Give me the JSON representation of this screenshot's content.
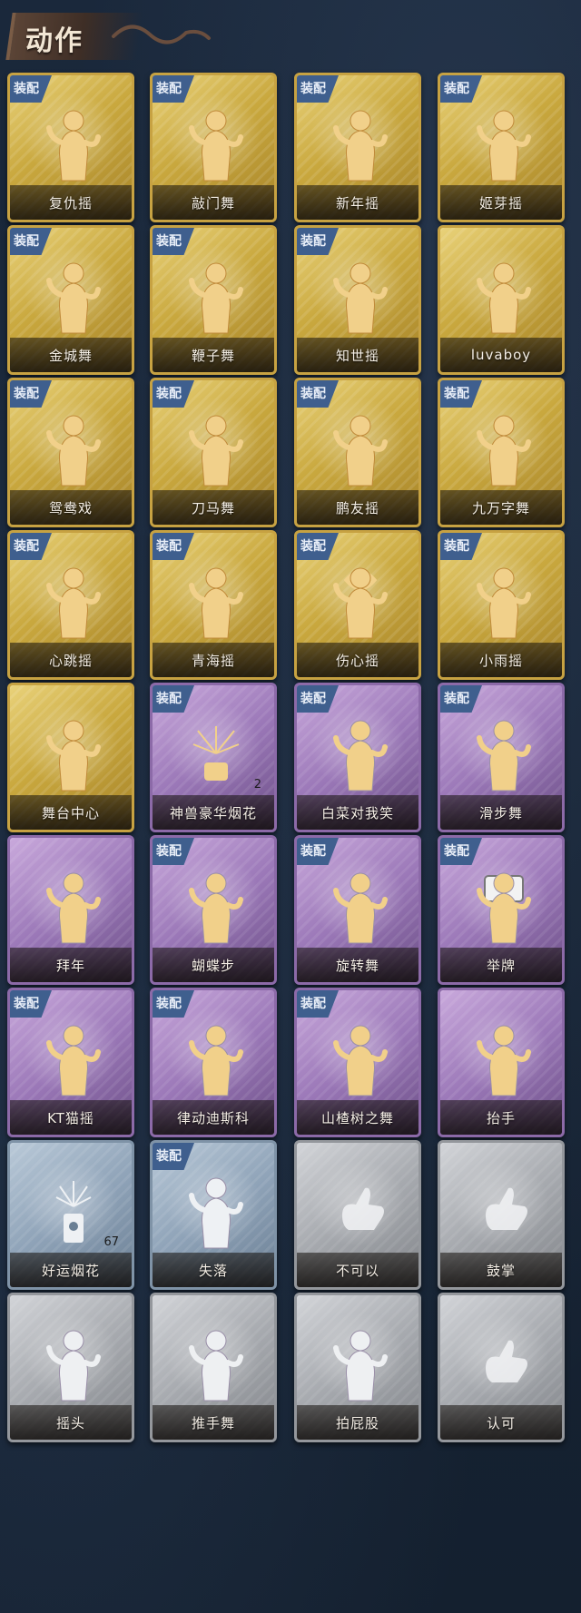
{
  "section_title": "动作",
  "badge_label": "装配",
  "colors": {
    "gold": "#c9a83e",
    "purple": "#9b78b8",
    "blue": "#8fa3b8",
    "gray": "#a6a9ae",
    "badge": "#3f5f8e",
    "background": "#152234"
  },
  "cards": [
    {
      "label": "复仇摇",
      "rarity": "gold",
      "equipped": true,
      "icon": "dance-figure-icon"
    },
    {
      "label": "敲门舞",
      "rarity": "gold",
      "equipped": true,
      "icon": "dance-figure-icon"
    },
    {
      "label": "新年摇",
      "rarity": "gold",
      "equipped": true,
      "icon": "dance-figure-icon"
    },
    {
      "label": "姬芽摇",
      "rarity": "gold",
      "equipped": true,
      "icon": "dance-figure-icon"
    },
    {
      "label": "金城舞",
      "rarity": "gold",
      "equipped": true,
      "icon": "dance-figure-icon"
    },
    {
      "label": "鞭子舞",
      "rarity": "gold",
      "equipped": true,
      "icon": "dance-figure-icon"
    },
    {
      "label": "知世摇",
      "rarity": "gold",
      "equipped": true,
      "icon": "dance-figure-icon"
    },
    {
      "label": "luvaboy",
      "rarity": "gold",
      "equipped": false,
      "icon": "dance-figure-icon"
    },
    {
      "label": "鸳鸯戏",
      "rarity": "gold",
      "equipped": true,
      "icon": "dance-figure-icon"
    },
    {
      "label": "刀马舞",
      "rarity": "gold",
      "equipped": true,
      "icon": "dance-figure-icon"
    },
    {
      "label": "鹏友摇",
      "rarity": "gold",
      "equipped": true,
      "icon": "dance-figure-icon"
    },
    {
      "label": "九万字舞",
      "rarity": "gold",
      "equipped": true,
      "icon": "dance-figure-icon"
    },
    {
      "label": "心跳摇",
      "rarity": "gold",
      "equipped": true,
      "icon": "dance-figure-icon"
    },
    {
      "label": "青海摇",
      "rarity": "gold",
      "equipped": true,
      "icon": "dance-figure-icon"
    },
    {
      "label": "伤心摇",
      "rarity": "gold",
      "equipped": true,
      "icon": "heart-hands-icon"
    },
    {
      "label": "小雨摇",
      "rarity": "gold",
      "equipped": true,
      "icon": "dance-figure-icon"
    },
    {
      "label": "舞台中心",
      "rarity": "gold",
      "equipped": false,
      "icon": "dance-figure-icon"
    },
    {
      "label": "神兽豪华烟花",
      "rarity": "purple",
      "equipped": true,
      "icon": "fireworks-icon",
      "count": "2"
    },
    {
      "label": "白菜对我笑",
      "rarity": "purple",
      "equipped": true,
      "icon": "dance-figure-icon"
    },
    {
      "label": "滑步舞",
      "rarity": "purple",
      "equipped": true,
      "icon": "dance-figure-icon"
    },
    {
      "label": "拜年",
      "rarity": "purple",
      "equipped": false,
      "icon": "bow-figure-icon"
    },
    {
      "label": "蝴蝶步",
      "rarity": "purple",
      "equipped": true,
      "icon": "dance-figure-icon"
    },
    {
      "label": "旋转舞",
      "rarity": "purple",
      "equipped": true,
      "icon": "spin-figure-icon"
    },
    {
      "label": "举牌",
      "rarity": "purple",
      "equipped": true,
      "icon": "sign-figure-icon"
    },
    {
      "label": "KT猫摇",
      "rarity": "purple",
      "equipped": true,
      "icon": "dance-figure-icon"
    },
    {
      "label": "律动迪斯科",
      "rarity": "purple",
      "equipped": true,
      "icon": "disco-figure-icon"
    },
    {
      "label": "山楂树之舞",
      "rarity": "purple",
      "equipped": true,
      "icon": "dance-figure-icon"
    },
    {
      "label": "抬手",
      "rarity": "purple",
      "equipped": false,
      "icon": "raise-hand-icon"
    },
    {
      "label": "好运烟花",
      "rarity": "blue",
      "equipped": false,
      "icon": "firework-can-icon",
      "count": "67"
    },
    {
      "label": "失落",
      "rarity": "blue",
      "equipped": true,
      "icon": "crawl-figure-icon"
    },
    {
      "label": "不可以",
      "rarity": "gray",
      "equipped": false,
      "icon": "finger-wag-icon"
    },
    {
      "label": "鼓掌",
      "rarity": "gray",
      "equipped": false,
      "icon": "clap-hands-icon"
    },
    {
      "label": "摇头",
      "rarity": "gray",
      "equipped": false,
      "icon": "shake-head-icon"
    },
    {
      "label": "推手舞",
      "rarity": "gray",
      "equipped": false,
      "icon": "push-hands-icon"
    },
    {
      "label": "拍屁股",
      "rarity": "gray",
      "equipped": false,
      "icon": "slap-figure-icon"
    },
    {
      "label": "认可",
      "rarity": "gray",
      "equipped": false,
      "icon": "thumbs-up-icon"
    }
  ]
}
